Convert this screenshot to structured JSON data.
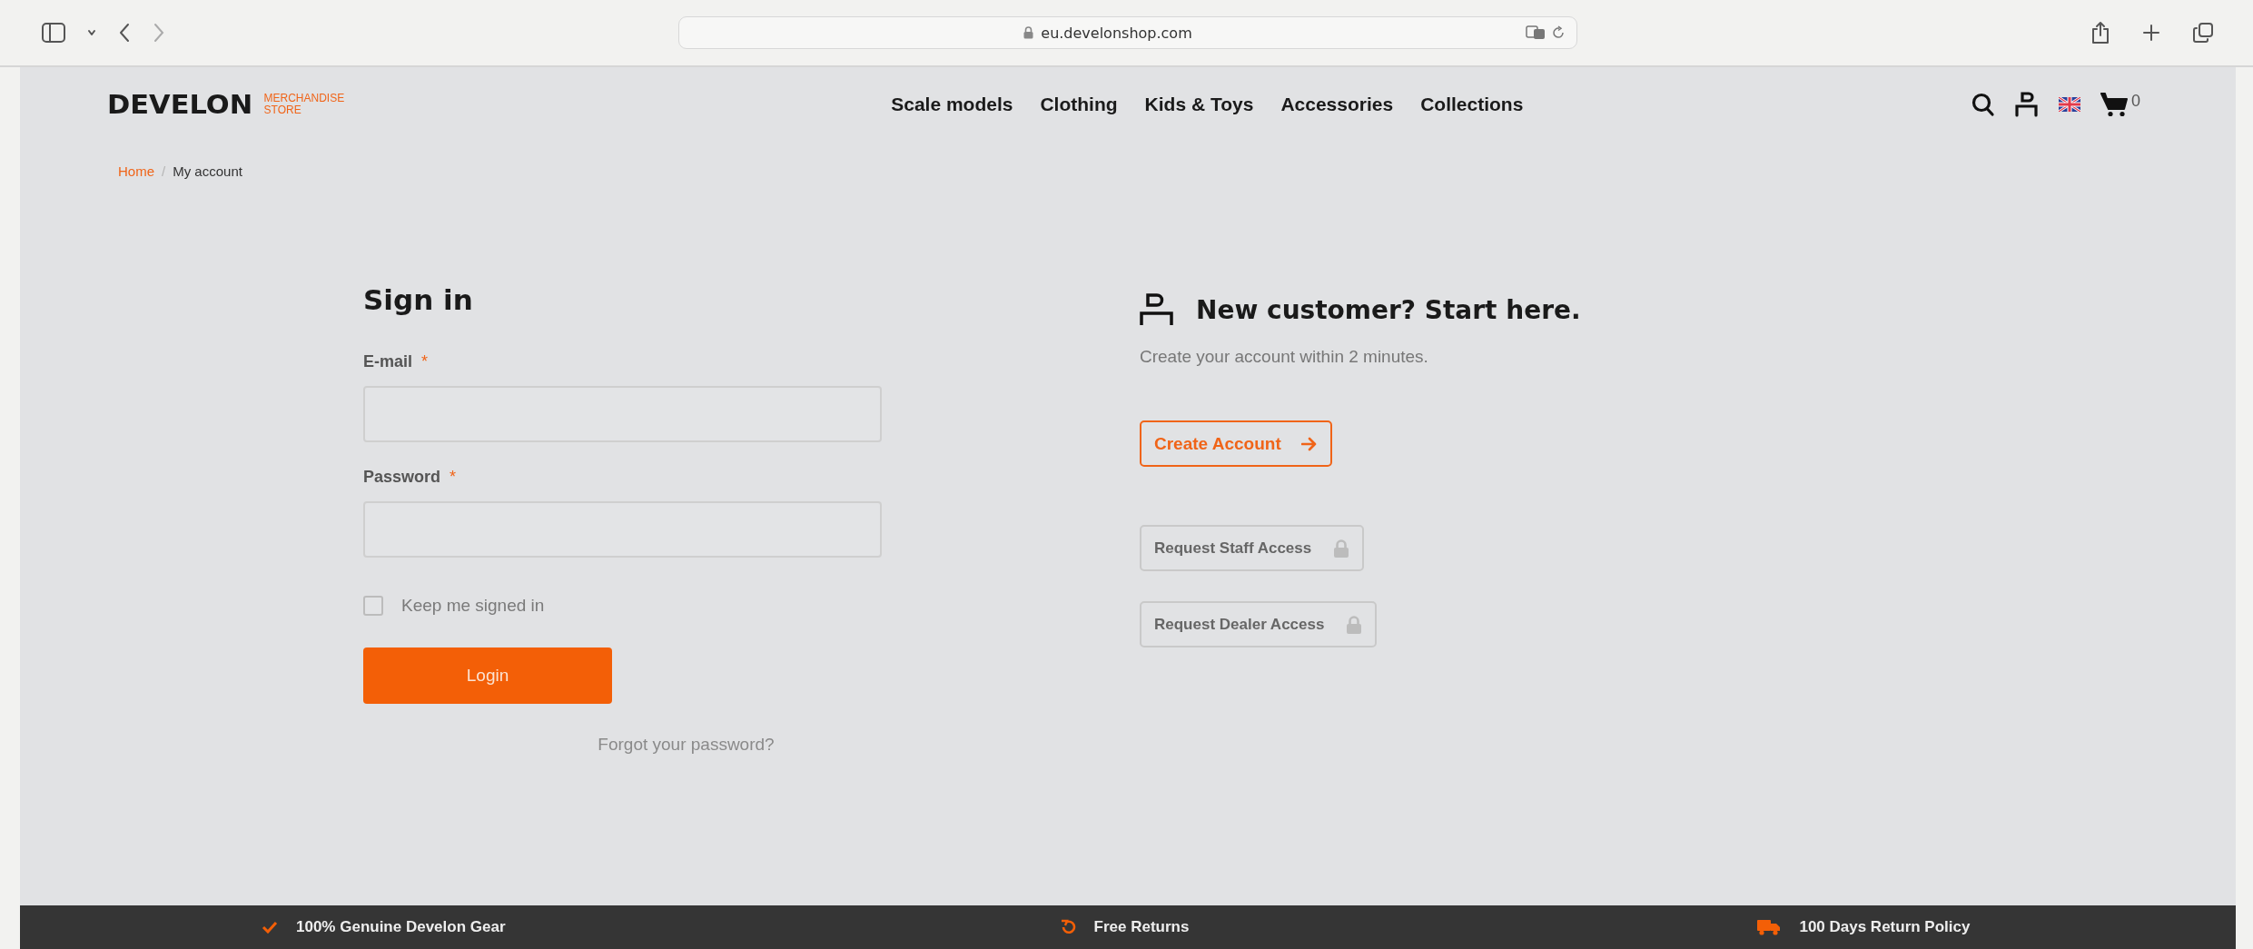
{
  "browser": {
    "url": "eu.develonshop.com"
  },
  "header": {
    "logo": {
      "brand": "DEVELON",
      "tagline_lines": [
        "MERCHANDISE",
        "STORE"
      ]
    },
    "nav": [
      "Scale models",
      "Clothing",
      "Kids & Toys",
      "Accessories",
      "Collections"
    ],
    "cart_count": "0"
  },
  "breadcrumb": [
    {
      "label": "Home",
      "kind": "link"
    },
    {
      "label": "/",
      "kind": "separator"
    },
    {
      "label": "My account",
      "kind": "current"
    }
  ],
  "sign_in": {
    "title": "Sign in",
    "fields": [
      {
        "label": "E-mail",
        "required_mark": "*"
      },
      {
        "label": "Password",
        "required_mark": "*"
      }
    ],
    "remember": {
      "label": "Keep me signed in",
      "checked": false
    },
    "login_button": "Login",
    "forgot_link": "Forgot your password?"
  },
  "register": {
    "title": "New customer? Start here.",
    "subtitle": "Create your account within 2 minutes.",
    "create_button": "Create Account",
    "access_buttons": [
      {
        "label": "Request Staff Access",
        "locked": true
      },
      {
        "label": "Request Dealer Access",
        "locked": true
      }
    ]
  },
  "footer": {
    "features": [
      {
        "label": "100% Genuine Develon Gear",
        "kind": "check"
      },
      {
        "label": "Free Returns",
        "kind": "return"
      },
      {
        "label": "100 Days Return Policy",
        "kind": "truck"
      }
    ]
  }
}
